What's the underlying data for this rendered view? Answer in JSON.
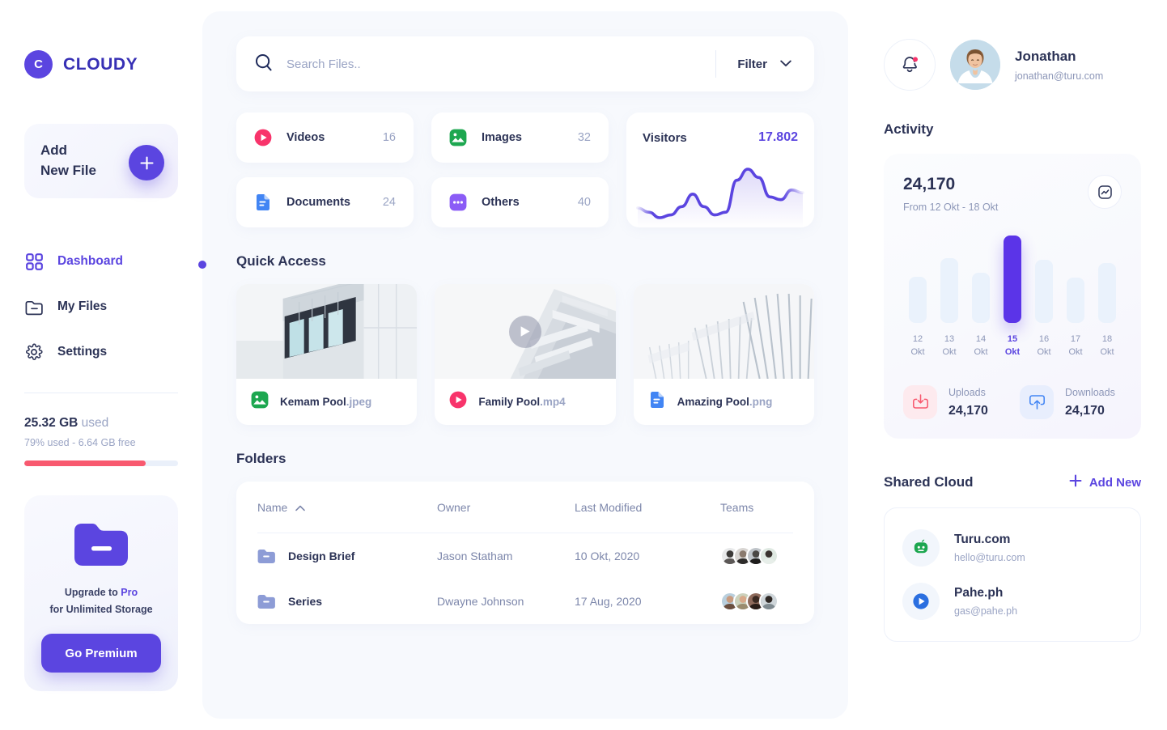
{
  "brand": {
    "initial": "C",
    "name": "CLOUDY"
  },
  "sidebar": {
    "add_file_label": "Add\nNew File",
    "add_file_line1": "Add",
    "add_file_line2": "New File",
    "nav": [
      {
        "label": "Dashboard",
        "icon": "grid-icon",
        "active": true
      },
      {
        "label": "My Files",
        "icon": "folder-icon",
        "active": false
      },
      {
        "label": "Settings",
        "icon": "gear-icon",
        "active": false
      }
    ],
    "storage": {
      "amount": "25.32 GB",
      "used_word": " used",
      "detail": "79% used - 6.64 GB free",
      "percent": 79,
      "bar_color": "#f8596f"
    },
    "promo": {
      "line1_prefix": "Upgrade to ",
      "line1_accent": "Pro",
      "line2": "for Unlimited Storage",
      "button": "Go Premium"
    }
  },
  "search": {
    "placeholder": "Search Files..",
    "value": "",
    "filter_label": "Filter"
  },
  "stats": [
    {
      "name": "Videos",
      "count": "16",
      "icon": "video-icon",
      "color": "#f8346b"
    },
    {
      "name": "Images",
      "count": "32",
      "icon": "image-icon",
      "color": "#1da750"
    },
    {
      "name": "Documents",
      "count": "24",
      "icon": "document-icon",
      "color": "#4285f4"
    },
    {
      "name": "Others",
      "count": "40",
      "icon": "dots-icon",
      "color": "#8b5cf6"
    }
  ],
  "visitors": {
    "title": "Visitors",
    "value": "17.802"
  },
  "quick_access": {
    "title": "Quick Access",
    "items": [
      {
        "name": "Kemam Pool",
        "ext": ".jpeg",
        "icon": "image-icon",
        "color": "#1da750",
        "type": "image"
      },
      {
        "name": "Family Pool",
        "ext": ".mp4",
        "icon": "video-icon",
        "color": "#f8346b",
        "type": "video"
      },
      {
        "name": "Amazing Pool",
        "ext": ".png",
        "icon": "document-icon",
        "color": "#4285f4",
        "type": "image"
      }
    ]
  },
  "folders": {
    "title": "Folders",
    "columns": [
      "Name",
      "Owner",
      "Last Modified",
      "Teams"
    ],
    "sort_column": "Name",
    "sort_direction": "asc",
    "rows": [
      {
        "name": "Design Brief",
        "owner": "Jason Statham",
        "modified": "10 Okt, 2020",
        "team_count": 4
      },
      {
        "name": "Series",
        "owner": "Dwayne Johnson",
        "modified": "17 Aug, 2020",
        "team_count": 4
      }
    ]
  },
  "user": {
    "name": "Jonathan",
    "email": "jonathan@turu.com",
    "has_notification": true
  },
  "activity": {
    "title": "Activity",
    "value": "24,170",
    "range": "From 12 Okt - 18 Okt",
    "uploads": {
      "label": "Uploads",
      "value": "24,170",
      "icon": "upload-icon",
      "color": "#f8596f"
    },
    "downloads": {
      "label": "Downloads",
      "value": "24,170",
      "icon": "download-icon",
      "color": "#4285f4"
    }
  },
  "chart_data": {
    "type": "bar",
    "title": "Activity",
    "categories": [
      "12 Okt",
      "13 Okt",
      "14 Okt",
      "15 Okt",
      "16 Okt",
      "17 Okt",
      "18 Okt"
    ],
    "day_numbers": [
      "12",
      "13",
      "14",
      "15",
      "16",
      "17",
      "18"
    ],
    "month_labels": [
      "Okt",
      "Okt",
      "Okt",
      "Okt",
      "Okt",
      "Okt",
      "Okt"
    ],
    "values": [
      57,
      80,
      62,
      108,
      78,
      56,
      74
    ],
    "highlight_index": 3,
    "highlight_color": "#5b34e8",
    "bar_color": "#eaf2fc",
    "xlabel": "",
    "ylabel": "",
    "grid": false,
    "legend": false
  },
  "visitors_chart": {
    "type": "line",
    "title": "Visitors",
    "total": "17.802",
    "line_color": "#5b45e0",
    "values": [
      28,
      22,
      14,
      18,
      30,
      48,
      30,
      18,
      22,
      68,
      84,
      72,
      44,
      40,
      54,
      50
    ],
    "grid": false,
    "legend": false
  },
  "shared_cloud": {
    "title": "Shared Cloud",
    "add_label": "Add New",
    "items": [
      {
        "name": "Turu.com",
        "email": "hello@turu.com",
        "icon": "turu-logo-icon",
        "color": "#1da750"
      },
      {
        "name": "Pahe.ph",
        "email": "gas@pahe.ph",
        "icon": "play-circle-icon",
        "color": "#2b6fe0"
      }
    ]
  }
}
